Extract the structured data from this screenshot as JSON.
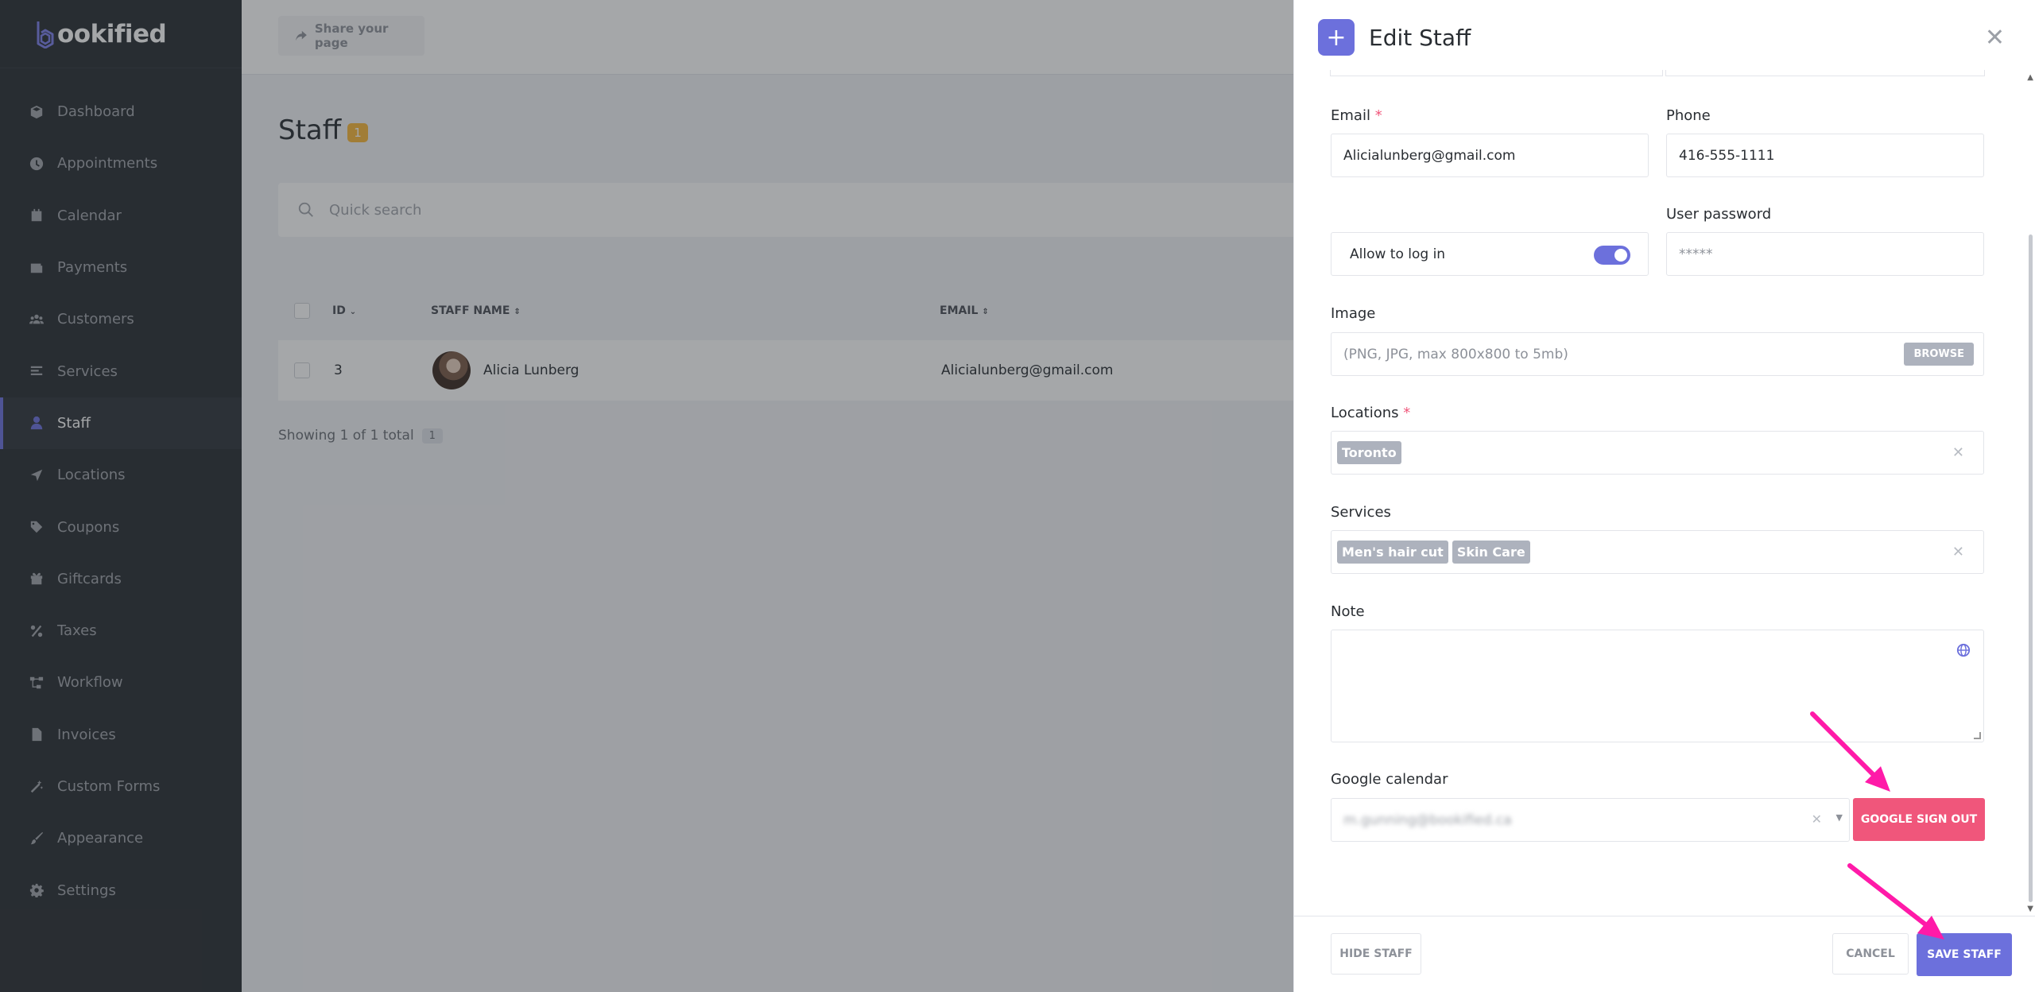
{
  "app": {
    "logo_text": "ookified"
  },
  "sidebar": {
    "items": [
      {
        "label": "Dashboard",
        "icon": "cube-icon"
      },
      {
        "label": "Appointments",
        "icon": "clock-icon"
      },
      {
        "label": "Calendar",
        "icon": "calendar-icon"
      },
      {
        "label": "Payments",
        "icon": "wallet-icon"
      },
      {
        "label": "Customers",
        "icon": "users-icon"
      },
      {
        "label": "Services",
        "icon": "list-icon"
      },
      {
        "label": "Staff",
        "icon": "user-icon",
        "active": true
      },
      {
        "label": "Locations",
        "icon": "location-arrow-icon"
      },
      {
        "label": "Coupons",
        "icon": "tag-icon"
      },
      {
        "label": "Giftcards",
        "icon": "gift-icon"
      },
      {
        "label": "Taxes",
        "icon": "percent-icon"
      },
      {
        "label": "Workflow",
        "icon": "workflow-icon"
      },
      {
        "label": "Invoices",
        "icon": "file-icon"
      },
      {
        "label": "Custom Forms",
        "icon": "magic-icon"
      },
      {
        "label": "Appearance",
        "icon": "brush-icon"
      },
      {
        "label": "Settings",
        "icon": "gear-icon"
      }
    ]
  },
  "topbar": {
    "share_label": "Share your page"
  },
  "page": {
    "title": "Staff",
    "count": "1",
    "search_placeholder": "Quick search",
    "columns": {
      "id": "ID",
      "name": "STAFF NAME",
      "email": "EMAIL"
    },
    "row": {
      "id": "3",
      "name": "Alicia Lunberg",
      "email": "Alicialunberg@gmail.com"
    },
    "showing": "Showing 1 of 1 total",
    "page_number": "1"
  },
  "modal": {
    "title": "Edit Staff",
    "email_label": "Email",
    "email_value": "Alicialunberg@gmail.com",
    "phone_label": "Phone",
    "phone_value": "416-555-1111",
    "allow_login_label": "Allow to log in",
    "allow_login_on": true,
    "password_label": "User password",
    "password_value": "*****",
    "image_label": "Image",
    "image_placeholder": "(PNG, JPG, max 800x800 to 5mb)",
    "browse_label": "BROWSE",
    "locations_label": "Locations",
    "locations": [
      "Toronto"
    ],
    "services_label": "Services",
    "services": [
      "Men's hair cut",
      "Skin Care"
    ],
    "note_label": "Note",
    "google_label": "Google calendar",
    "google_value": "m.gunning@bookified.ca",
    "google_signout_label": "GOOGLE SIGN OUT",
    "hide_label": "HIDE STAFF",
    "cancel_label": "CANCEL",
    "save_label": "SAVE STAFF"
  },
  "colors": {
    "accent": "#6c70dc",
    "danger": "#f0567b",
    "annotation_arrow": "#ff1aa8",
    "sidebar_bg": "#292d32",
    "badge": "#f8b73a"
  }
}
